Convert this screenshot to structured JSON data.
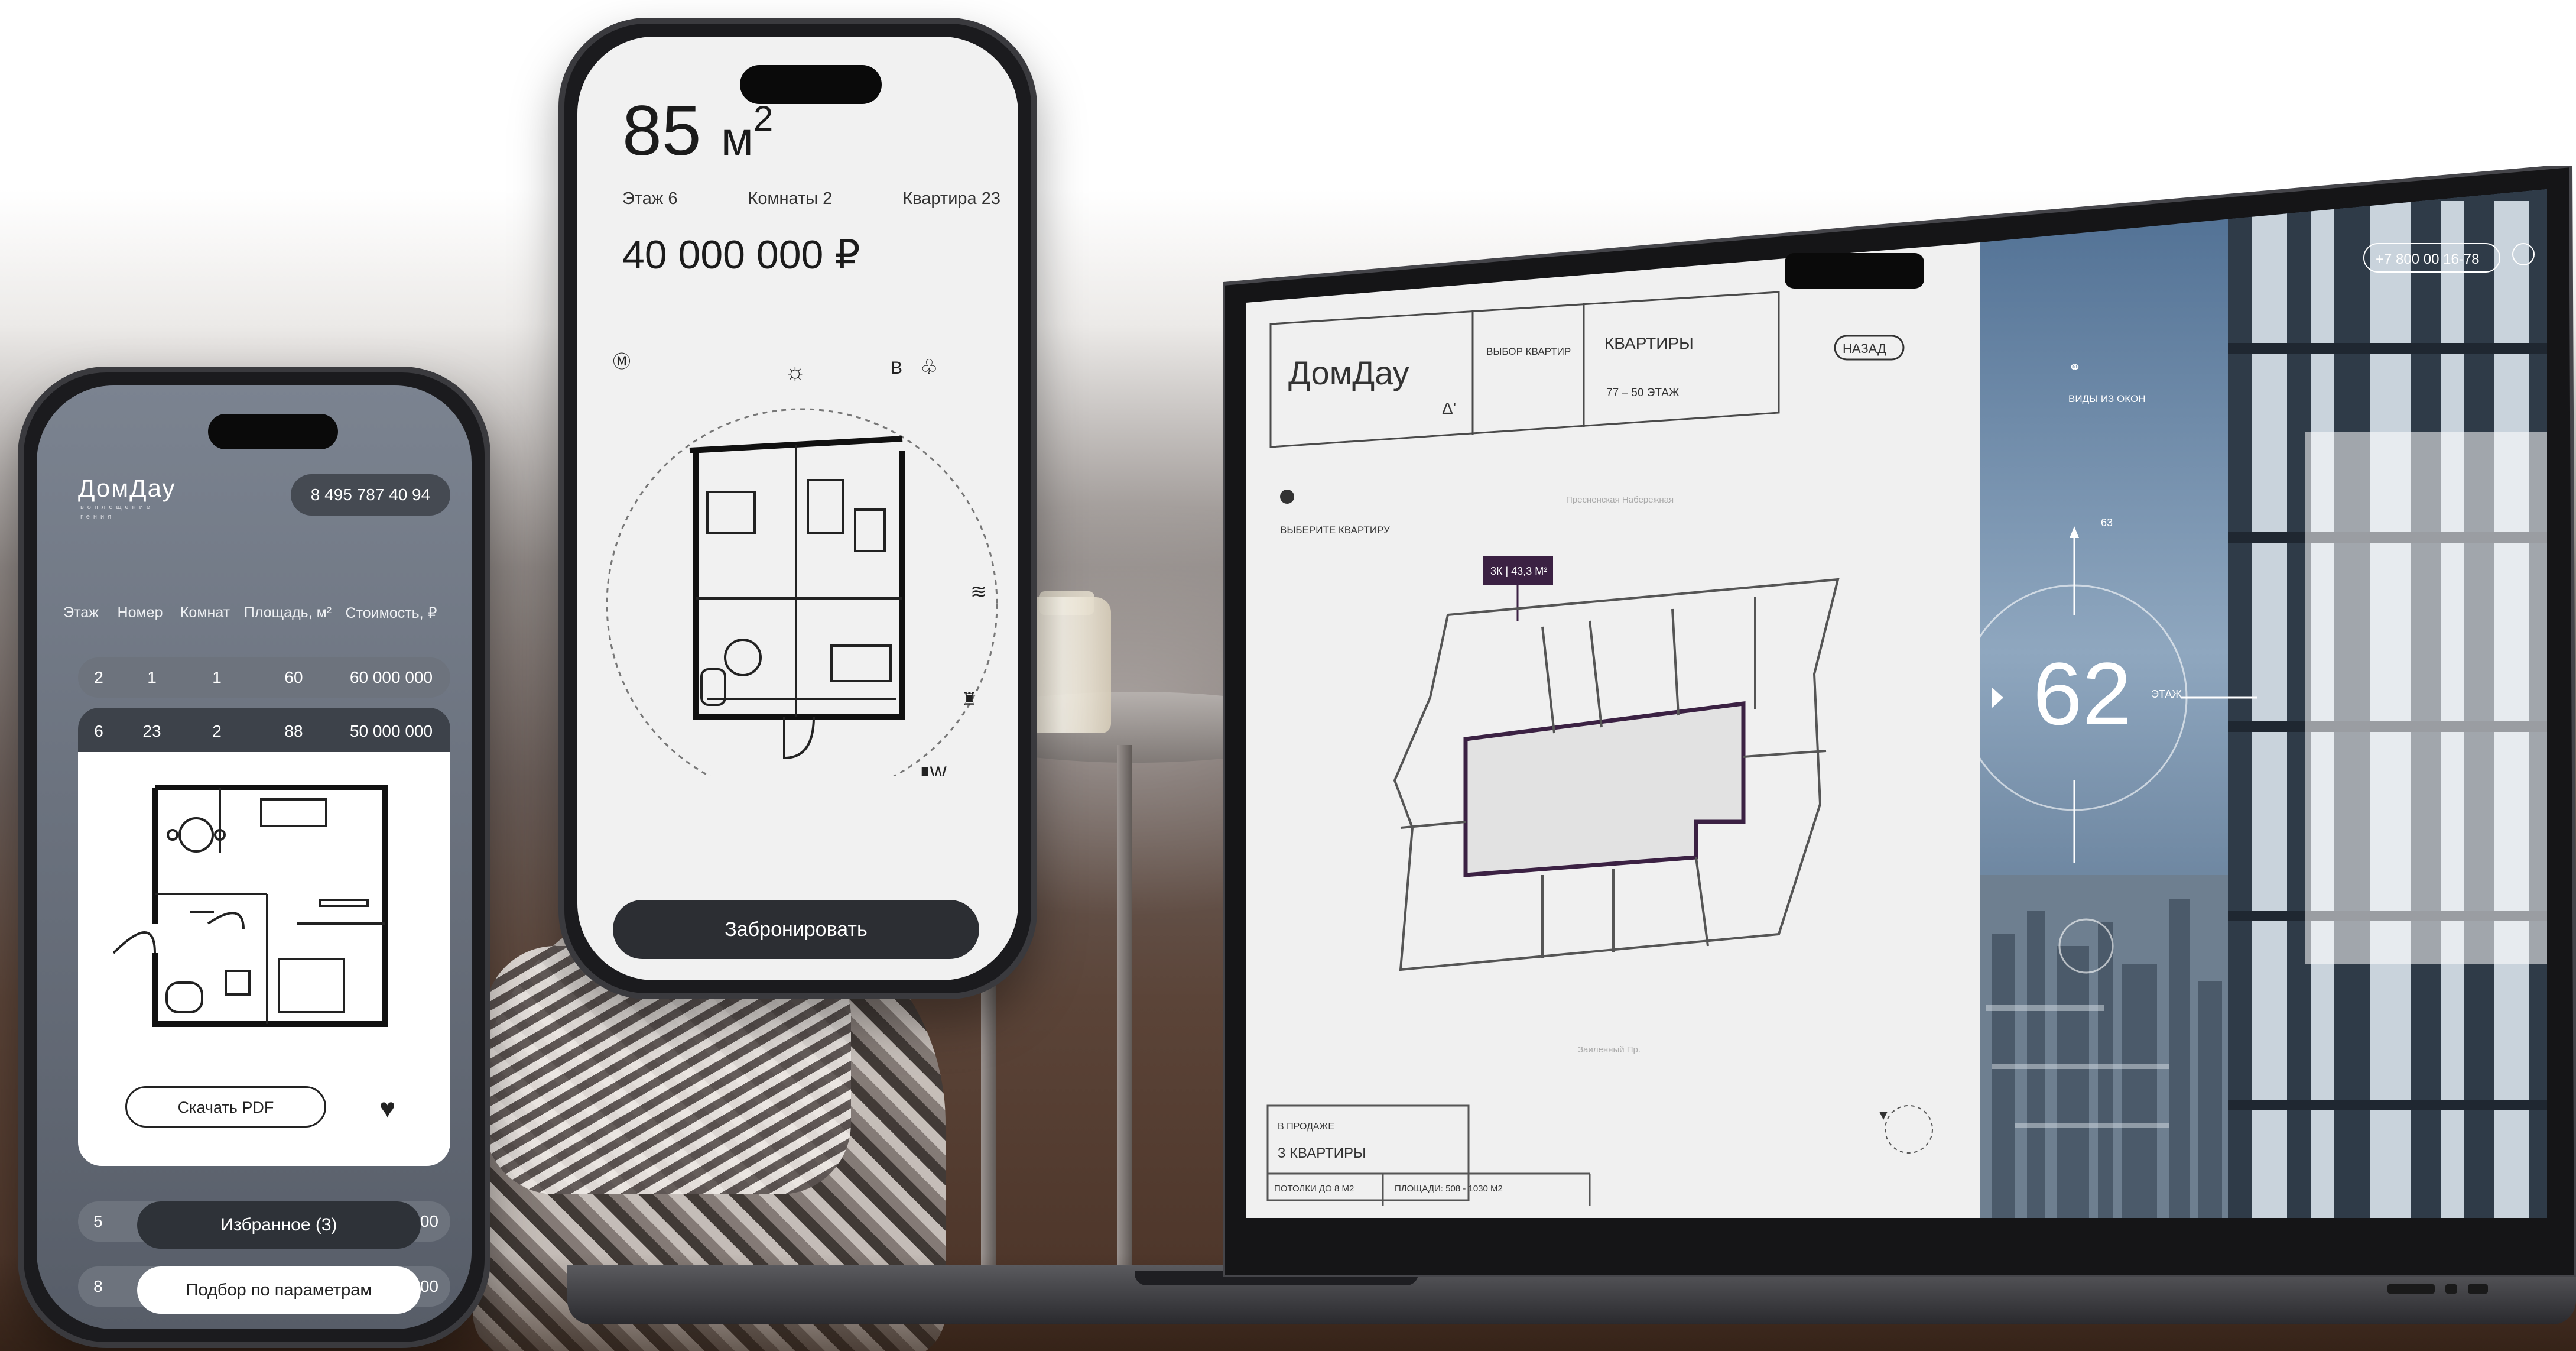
{
  "phone_list": {
    "logo": "ДомДау",
    "logo_tagline": "воплощение гения",
    "phone_number": "8 495 787 40 94",
    "columns": [
      "Этаж",
      "Номер",
      "Комнат",
      "Площадь, м²",
      "Стоимость, ₽"
    ],
    "rows": [
      {
        "floor": "2",
        "number": "1",
        "rooms": "1",
        "area": "60",
        "price": "60 000 000"
      },
      {
        "floor": "6",
        "number": "23",
        "rooms": "2",
        "area": "88",
        "price": "50 000 000"
      },
      {
        "floor": "5",
        "number": "",
        "rooms": "",
        "area": "",
        "price": "0 000"
      },
      {
        "floor": "8",
        "number": "",
        "rooms": "",
        "area": "",
        "price": "0 000"
      }
    ],
    "download_label": "Скачать PDF",
    "favorites_label": "Избранное (3)",
    "filter_label": "Подбор по параметрам"
  },
  "phone_detail": {
    "area_value": "85",
    "area_unit": "м",
    "area_sup": "2",
    "floor": "Этаж 6",
    "rooms": "Комнаты 2",
    "apartment": "Квартира 23",
    "price": "40 000 000 ₽",
    "compass_e": "В",
    "compass_w": "З",
    "book_label": "Забронировать"
  },
  "laptop_site": {
    "logo": "ДомДау",
    "nav_choose": "ВЫБОР КВАРТИР",
    "nav_title": "КВАРТИРЫ",
    "nav_floors": "77 – 50 ЭТАЖ",
    "back": "НАЗАД",
    "choose_apartment": "ВЫБЕРИТЕ КВАРТИРУ",
    "street_top": "Пресненская Набережная",
    "street_bottom": "Заиленный Пр.",
    "tooltip": "3К | 43,3 М²",
    "on_sale": "В ПРОДАЖЕ",
    "count": "3 КВАРТИРЫ",
    "ceilings": "ПОТОЛКИ ДО 8 М2",
    "areas": "ПЛОЩАДИ: 508 - 1030 М2",
    "views": "ВИДЫ ИЗ ОКОН",
    "phone": "+7 800 00 16-78",
    "floor_number": "62",
    "floor_label": "ЭТАЖ",
    "floor_up": "63"
  }
}
